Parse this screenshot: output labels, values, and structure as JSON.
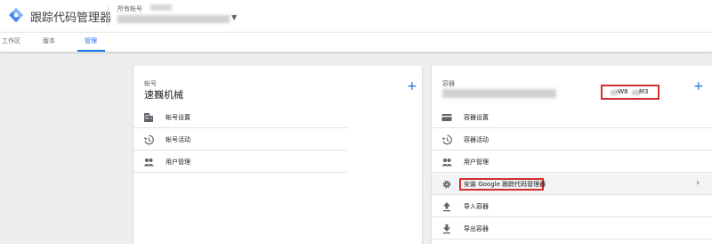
{
  "app": {
    "title": "跟踪代码管理器",
    "account_label": "所有帐号"
  },
  "tabs": [
    {
      "label": "工作区"
    },
    {
      "label": "版本"
    },
    {
      "label": "管理"
    }
  ],
  "account_card": {
    "label": "帐号",
    "name": "速巍机械",
    "rows": [
      {
        "label": "帐号设置",
        "icon": "building-icon"
      },
      {
        "label": "帐号活动",
        "icon": "history-icon"
      },
      {
        "label": "用户管理",
        "icon": "people-icon"
      }
    ]
  },
  "container_card": {
    "label": "容器",
    "container_id_part1": "-W8",
    "container_id_part2": "M3",
    "rows": [
      {
        "label": "容器设置",
        "icon": "card-icon"
      },
      {
        "label": "容器活动",
        "icon": "history-icon"
      },
      {
        "label": "用户管理",
        "icon": "people-icon"
      },
      {
        "label": "安装 Google 跟踪代码管理器",
        "icon": "gear-icon"
      },
      {
        "label": "导入容器",
        "icon": "upload-icon"
      },
      {
        "label": "导出容器",
        "icon": "download-icon"
      }
    ]
  },
  "colors": {
    "accent": "#1a73e8",
    "highlight": "#d32f2f"
  }
}
